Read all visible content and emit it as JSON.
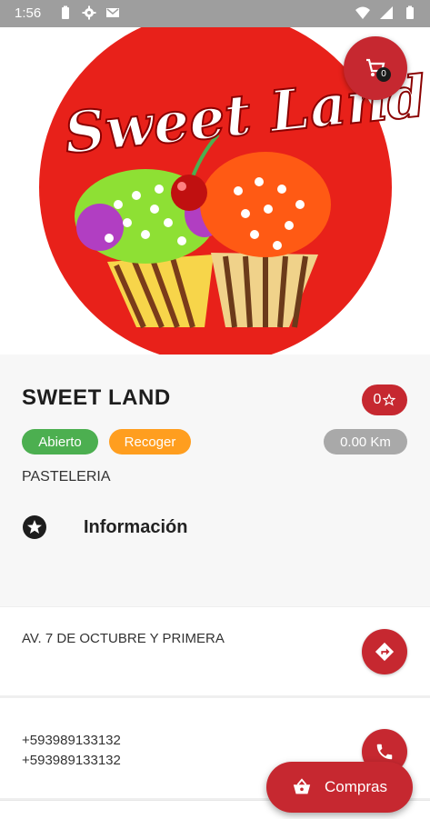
{
  "status_bar": {
    "time": "1:56"
  },
  "store": {
    "logo_text": "Sweet Land",
    "name": "SWEET LAND",
    "rating": "0",
    "status_open": "Abierto",
    "pickup": "Recoger",
    "distance": "0.00 Km",
    "category": "PASTELERIA",
    "info_label": "Información",
    "address": "AV. 7 DE OCTUBRE Y PRIMERA",
    "phones": [
      "+593989133132",
      "+593989133132"
    ]
  },
  "cart": {
    "count": "0"
  },
  "compras_label": "Compras",
  "colors": {
    "brand_red": "#c62830",
    "open_green": "#4caf50",
    "pickup_orange": "#ff9e1f",
    "distance_gray": "#a9a9a9"
  }
}
